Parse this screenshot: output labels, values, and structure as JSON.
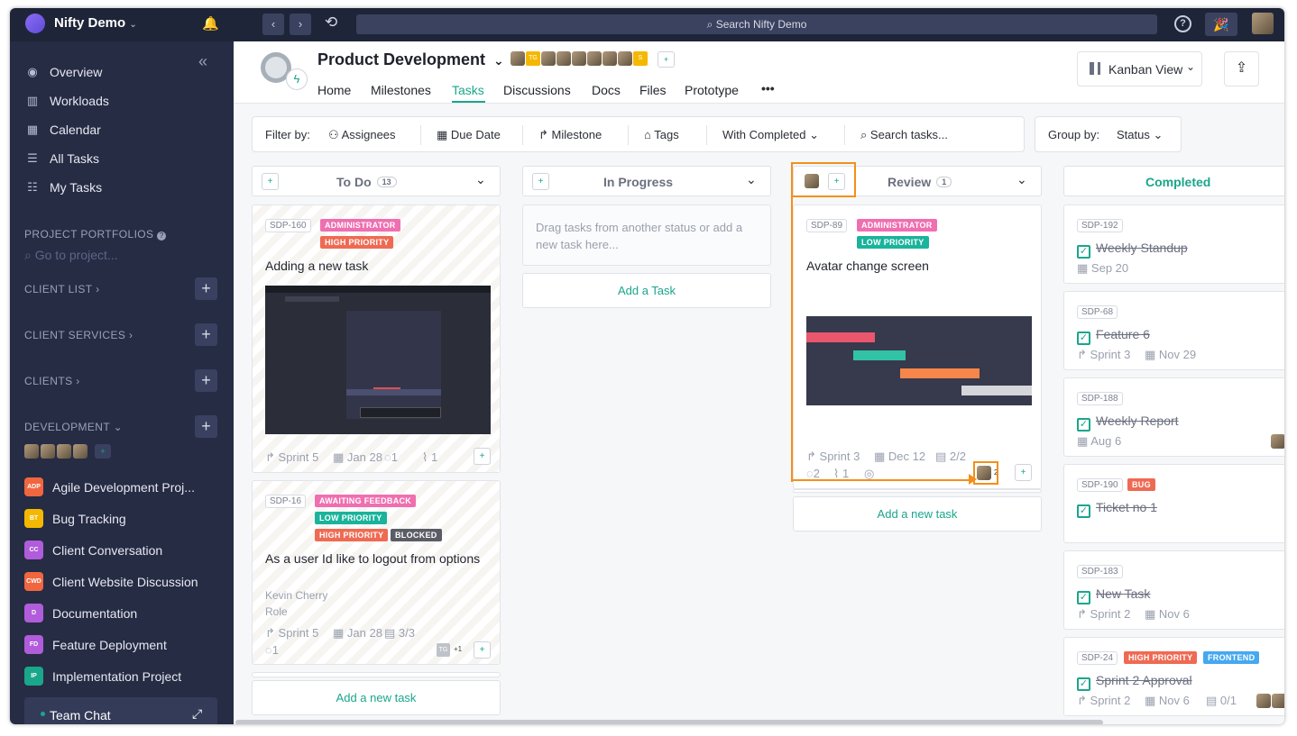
{
  "topbar": {
    "workspace": "Nifty Demo",
    "search_placeholder": "Search Nifty Demo",
    "help": "?",
    "back": "‹",
    "forward": "›"
  },
  "sidebar": {
    "nav": [
      {
        "label": "Overview",
        "icon": "compass-icon"
      },
      {
        "label": "Workloads",
        "icon": "bar-chart-icon"
      },
      {
        "label": "Calendar",
        "icon": "calendar-icon"
      },
      {
        "label": "All Tasks",
        "icon": "list-icon"
      },
      {
        "label": "My Tasks",
        "icon": "checklist-icon"
      }
    ],
    "project_portfolios": "PROJECT PORTFOLIOS",
    "go_to_project": "Go to project...",
    "sections": [
      "CLIENT LIST",
      "CLIENT SERVICES",
      "CLIENTS",
      "DEVELOPMENT"
    ],
    "projects": [
      {
        "badge": "ADP",
        "color": "#f0663f",
        "label": "Agile Development Proj..."
      },
      {
        "badge": "BT",
        "color": "#f5b800",
        "label": "Bug Tracking"
      },
      {
        "badge": "CC",
        "color": "#b05cdb",
        "label": "Client Conversation"
      },
      {
        "badge": "CWD",
        "color": "#f0663f",
        "label": "Client Website Discussion"
      },
      {
        "badge": "D",
        "color": "#b05cdb",
        "label": "Documentation"
      },
      {
        "badge": "FD",
        "color": "#b05cdb",
        "label": "Feature Deployment"
      },
      {
        "badge": "IP",
        "color": "#1aa68b",
        "label": "Implementation Project"
      }
    ],
    "team_chat": "Team Chat"
  },
  "header": {
    "project_title": "Product Development",
    "tabs": [
      "Home",
      "Milestones",
      "Tasks",
      "Discussions",
      "Docs",
      "Files",
      "Prototype"
    ],
    "active_tab": "Tasks",
    "more": "•••",
    "view": "Kanban View",
    "member_badges": [
      "TG",
      "S"
    ]
  },
  "filters": {
    "label": "Filter by:",
    "assignees": "Assignees",
    "due_date": "Due Date",
    "milestone": "Milestone",
    "tags": "Tags",
    "with_completed": "With Completed",
    "search": "Search tasks...",
    "group_label": "Group by:",
    "group_value": "Status"
  },
  "columns": {
    "todo": {
      "name": "To Do",
      "count": "13"
    },
    "inprogress": {
      "name": "In Progress",
      "empty": "Drag tasks from another status or add a new task here..."
    },
    "review": {
      "name": "Review",
      "count": "1"
    },
    "completed": {
      "name": "Completed"
    }
  },
  "todo_cards": [
    {
      "id": "SDP-160",
      "tags": [
        "ADMINISTRATOR",
        "HIGH PRIORITY"
      ],
      "title": "Adding a new task",
      "sprint": "Sprint 5",
      "date": "Jan 28",
      "comments": "1",
      "attachments": "1"
    },
    {
      "id": "SDP-16",
      "tags": [
        "AWAITING FEEDBACK",
        "LOW PRIORITY",
        "HIGH PRIORITY",
        "BLOCKED"
      ],
      "title": "As a user Id like to logout from options",
      "line1": "Kevin Cherry",
      "line2": "Role",
      "sprint": "Sprint 5",
      "date": "Jan 28",
      "subtasks": "3/3",
      "comments": "1",
      "avatar": "TG",
      "extra": "+1"
    }
  ],
  "review_card": {
    "id": "SDP-89",
    "tags": [
      "ADMINISTRATOR",
      "LOW PRIORITY"
    ],
    "title": "Avatar change screen",
    "sprint": "Sprint 3",
    "date": "Dec 12",
    "subtasks": "2/2",
    "comments": "2",
    "attachments": "1",
    "watchers": "2"
  },
  "completed_cards": [
    {
      "id": "SDP-192",
      "title": "Weekly Standup",
      "date": "Sep 20"
    },
    {
      "id": "SDP-68",
      "title": "Feature 6",
      "sprint": "Sprint 3",
      "date": "Nov 29"
    },
    {
      "id": "SDP-188",
      "title": "Weekly Report",
      "date": "Aug 6"
    },
    {
      "id": "SDP-190",
      "tag": "BUG",
      "title": "Ticket no 1"
    },
    {
      "id": "SDP-183",
      "title": "New Task",
      "sprint": "Sprint 2",
      "date": "Nov 6"
    },
    {
      "id": "SDP-24",
      "tags": [
        "HIGH PRIORITY",
        "FRONTEND"
      ],
      "title": "Sprint 2 Approval",
      "sprint": "Sprint 2",
      "date": "Nov 6",
      "subtasks": "0/1"
    }
  ],
  "add_task": "Add a Task",
  "add_new_task": "Add a new task",
  "colors": {
    "accent": "#1aa68b",
    "admin": "#ef6fb0",
    "high": "#ef6a53",
    "low": "#1ab39b",
    "awaiting": "#ef6fb0",
    "blocked": "#5a5d66",
    "bug": "#ef6a53",
    "frontend": "#45a8f0",
    "highlight": "#f39019"
  }
}
